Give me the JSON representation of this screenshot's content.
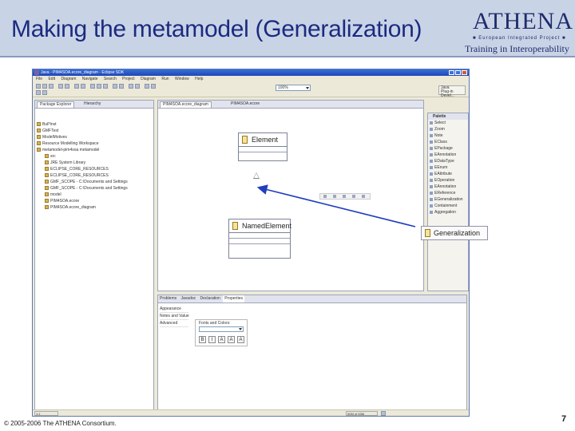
{
  "slide": {
    "title": "Making the metamodel (Generalization)",
    "logo": {
      "word": "ATHENA",
      "subtitle": "■ European Integrated Project ■",
      "tagline": "Training in Interoperability"
    },
    "copyright": "© 2005-2006 The ATHENA Consortium.",
    "page_number": "7"
  },
  "window": {
    "title": "Java - PIM4SOA.ecore_diagram - Eclipse SDK",
    "menu": [
      "File",
      "Edit",
      "Diagram",
      "Navigate",
      "Search",
      "Project",
      "Diagram",
      "Run",
      "Window",
      "Help"
    ],
    "zoom": "100%",
    "perspectives": [
      "Java",
      "Plug-in Devel..."
    ]
  },
  "package_explorer": {
    "tabs": [
      "Package Explorer",
      "Hierarchy"
    ],
    "tree": [
      "BuPInst",
      "GMFTest",
      "ModelMotives",
      "Resource Modelling Workspace",
      "metamodel-pim4soa metamodel",
      "src",
      "JRE System Library",
      "ECLIPSE_CORE_RESOURCES",
      "ECLIPSE_CORE_RESOURCES",
      "GMF_SCOPE - C:\\Documents and Settings",
      "GMF_SCOPE - C:\\Documents and Settings",
      "model",
      "PIM4SOA.ecore",
      "PIM4SOA.ecore_diagram"
    ]
  },
  "editor": {
    "tabs": [
      "PIM4SOA.ecore_diagram",
      "PIM4SOA.ecore"
    ],
    "classes": [
      "Element",
      "NamedElement"
    ]
  },
  "palette": {
    "title": "Palette",
    "items": [
      "Select",
      "Zoom",
      "Note",
      "EClass",
      "EPackage",
      "EAnnotation",
      "EDataType",
      "EEnum",
      "EAttribute",
      "EOperation",
      "EAnnotation",
      "EReference",
      "EGeneralization",
      "Containment",
      "Aggregation"
    ],
    "highlighted": "Generalization"
  },
  "properties": {
    "tabs": [
      "Problems",
      "Javadoc",
      "Declaration",
      "Properties"
    ],
    "side_tabs": [
      "Appearance",
      "Notes and Value",
      "Advanced"
    ],
    "fonts_label": "Fonts and Colors:",
    "font_buttons": [
      "B",
      "I",
      "A",
      "A",
      "A"
    ]
  },
  "statusbar": {
    "position": "1:1",
    "memory": "50M of 63M"
  }
}
